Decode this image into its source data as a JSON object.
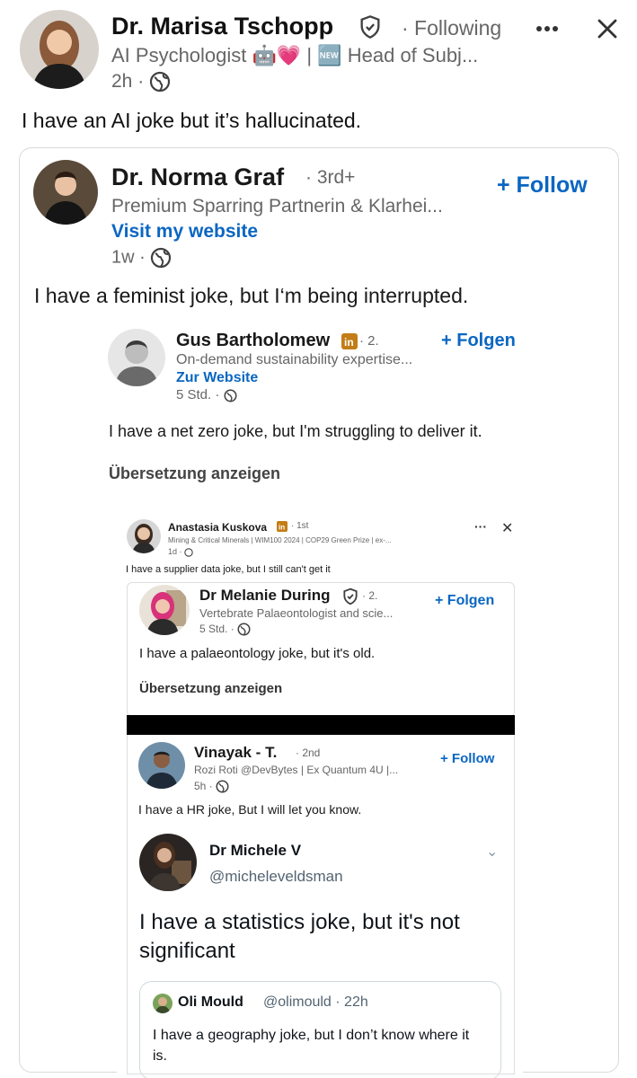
{
  "post": {
    "author_name": "Dr. Marisa Tschopp",
    "following_label": "· Following",
    "headline": "AI Psychologist 🤖💗 | 🆕 Head of Subj...",
    "time": "2h ·",
    "more_icon": "ellipsis-icon",
    "close_icon": "close-icon",
    "text": "I have an AI joke but it’s hallucinated."
  },
  "quote1": {
    "author_name": "Dr. Norma Graf",
    "degree": "· 3rd+",
    "headline": "Premium Sparring Partnerin & Klarhei...",
    "website": "Visit my website",
    "time": "1w ·",
    "follow_label": "+ Follow",
    "text": "I have a feminist joke, but I‘m being interrupted."
  },
  "quote2": {
    "author_name": "Gus Bartholomew",
    "degree": "· 2.",
    "headline": "On-demand sustainability expertise...",
    "website": "Zur Website",
    "time": "5 Std. ·",
    "follow_label": "+ Folgen",
    "text": "I have a net zero joke, but I'm struggling to deliver it.",
    "translate": "Übersetzung anzeigen"
  },
  "quote3": {
    "author_name": "Anastasia Kuskova",
    "degree": "· 1st",
    "headline": "Mining & Critical Minerals | WIM100 2024 | COP29 Green Prize | ex-...",
    "time": "1d ·",
    "more_label": "···",
    "close_label": "✕",
    "text": "I have a supplier data joke, but I still can't get it"
  },
  "quote4": {
    "author_name": "Dr Melanie During",
    "degree": "· 2.",
    "headline": "Vertebrate Palaeontologist and scie...",
    "time": "5 Std. ·",
    "follow_label": "+ Folgen",
    "text": "I have a palaeontology joke, but it's old.",
    "translate": "Übersetzung anzeigen"
  },
  "quote5": {
    "author_name": "Vinayak - T.",
    "degree": "· 2nd",
    "headline": "Rozi Roti @DevBytes | Ex Quantum 4U |...",
    "time": "5h ·",
    "follow_label": "+ Follow",
    "text": "I have a HR joke, But I will let you know."
  },
  "tweet": {
    "author_name": "Dr Michele V",
    "handle": "@micheleveldsman",
    "chevron": "⌄",
    "text": "I have a statistics joke, but it's not significant"
  },
  "tweet_quote": {
    "author_name": "Oli Mould",
    "handle": "@olimould · 22h",
    "text": "I have a geography joke, but I don’t know where it is."
  },
  "colors": {
    "link_blue": "#0a66c2",
    "meta_gray": "#666666",
    "linkedin_badge": "#c37d16"
  }
}
